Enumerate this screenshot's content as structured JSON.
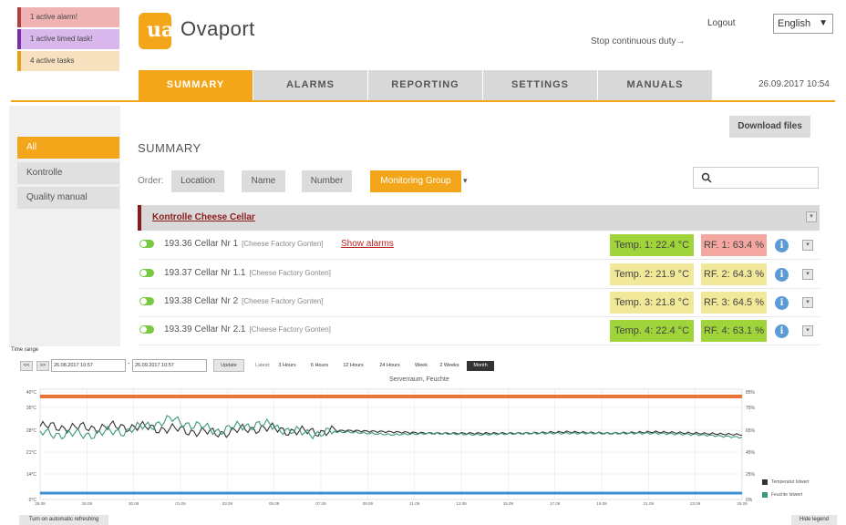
{
  "status": {
    "alarm": "1 active alarm!",
    "timed_task": "1 active timed task!",
    "tasks": "4 active tasks"
  },
  "header": {
    "logo_text": "ua",
    "app_title": "Ovaport",
    "logout": "Logout",
    "language": "English",
    "stop_link": "Stop continuous duty→"
  },
  "nav": {
    "tabs": [
      {
        "label": "SUMMARY",
        "active": true
      },
      {
        "label": "ALARMS",
        "active": false
      },
      {
        "label": "REPORTING",
        "active": false
      },
      {
        "label": "SETTINGS",
        "active": false
      },
      {
        "label": "MANUALS",
        "active": false
      }
    ],
    "datetime": "26.09.2017 10:54"
  },
  "sidebar": {
    "items": [
      {
        "label": "All",
        "active": true
      },
      {
        "label": "Kontrolle",
        "active": false
      },
      {
        "label": "Quality manual",
        "active": false
      }
    ]
  },
  "main": {
    "download_label": "Download files",
    "title": "SUMMARY",
    "order_label": "Order:",
    "order_buttons": [
      {
        "label": "Location",
        "active": false
      },
      {
        "label": "Name",
        "active": false
      },
      {
        "label": "Number",
        "active": false
      },
      {
        "label": "Monitoring Group",
        "active": true
      }
    ],
    "order_caret": "▾",
    "group_title": "Kontrolle Cheese Cellar",
    "rows": [
      {
        "name": "193.36 Cellar Nr 1",
        "location": "[Cheese Factory Gonten]",
        "alarm_link": "Show alarms",
        "temp": "Temp. 1: 22.4 °C",
        "rf": "RF. 1: 63.4 %",
        "temp_color": "#9fd43a",
        "rf_color": "#f4a7a0"
      },
      {
        "name": "193.37 Cellar Nr 1.1",
        "location": "[Cheese Factory Gonten]",
        "alarm_link": "",
        "temp": "Temp. 2: 21.9 °C",
        "rf": "RF. 2: 64.3 %",
        "temp_color": "#f2e89a",
        "rf_color": "#f2e89a"
      },
      {
        "name": "193.38 Cellar Nr 2",
        "location": "[Cheese Factory Gonten]",
        "alarm_link": "",
        "temp": "Temp. 3: 21.8 °C",
        "rf": "RF. 3: 64.5 %",
        "temp_color": "#f2e89a",
        "rf_color": "#f2e89a"
      },
      {
        "name": "193.39 Cellar Nr 2.1",
        "location": "[Cheese Factory Gonten]",
        "alarm_link": "",
        "temp": "Temp. 4: 22.4 °C",
        "rf": "RF. 4: 63.1 %",
        "temp_color": "#9fd43a",
        "rf_color": "#9fd43a"
      }
    ]
  },
  "timerange": {
    "label": "Time range",
    "prev": "<<",
    "next": ">>",
    "from": "26.08.2017 10:57",
    "to": "26.09.2017 10:57",
    "update": "Update",
    "zoom_label": "Latest:",
    "zoom": [
      {
        "label": "3 Hours",
        "active": false
      },
      {
        "label": "6 Hours",
        "active": false
      },
      {
        "label": "12 Hours",
        "active": false
      },
      {
        "label": "24 Hours",
        "active": false
      },
      {
        "label": "Week",
        "active": false
      },
      {
        "label": "2 Weeks",
        "active": false
      },
      {
        "label": "Month",
        "active": true
      }
    ]
  },
  "chart_data": {
    "type": "line",
    "title": "Serverraum, Feuchte",
    "y_left_ticks": [
      "0°C",
      "14°C",
      "21°C",
      "28°C",
      "35°C",
      "40°C"
    ],
    "y_right_ticks": [
      "85%",
      "75%",
      "65%",
      "45%",
      "25%",
      "0%"
    ],
    "x": [
      "26.08",
      "28.08",
      "30.08",
      "01.09",
      "03.09",
      "05.09",
      "07.09",
      "09.09",
      "11.09",
      "13.09",
      "15.09",
      "17.09",
      "19.09",
      "21.09",
      "23.09",
      "25.09"
    ],
    "threshold_upper_color": "#e8743b",
    "threshold_lower_color": "#3d8fd1",
    "series": [
      {
        "name": "Temperatur Istwert",
        "color": "#333333",
        "values": [
          26.5,
          26,
          26.5,
          25.5,
          24,
          26,
          24.5,
          25,
          24.5,
          24,
          24,
          24,
          24.5,
          24,
          24.5,
          24,
          23.5
        ]
      },
      {
        "name": "Feuchte Istwert",
        "color": "#3c9a72",
        "values": [
          24,
          23.5,
          25,
          29,
          25,
          27.5,
          24,
          24.5,
          23.5,
          24,
          23.5,
          24,
          24,
          24,
          24,
          23.5,
          22.5
        ]
      }
    ],
    "legend_position": "bottom-right"
  },
  "footer": {
    "auto_refresh": "Turn on automatic refreshing",
    "hide_legend": "Hide legend"
  }
}
